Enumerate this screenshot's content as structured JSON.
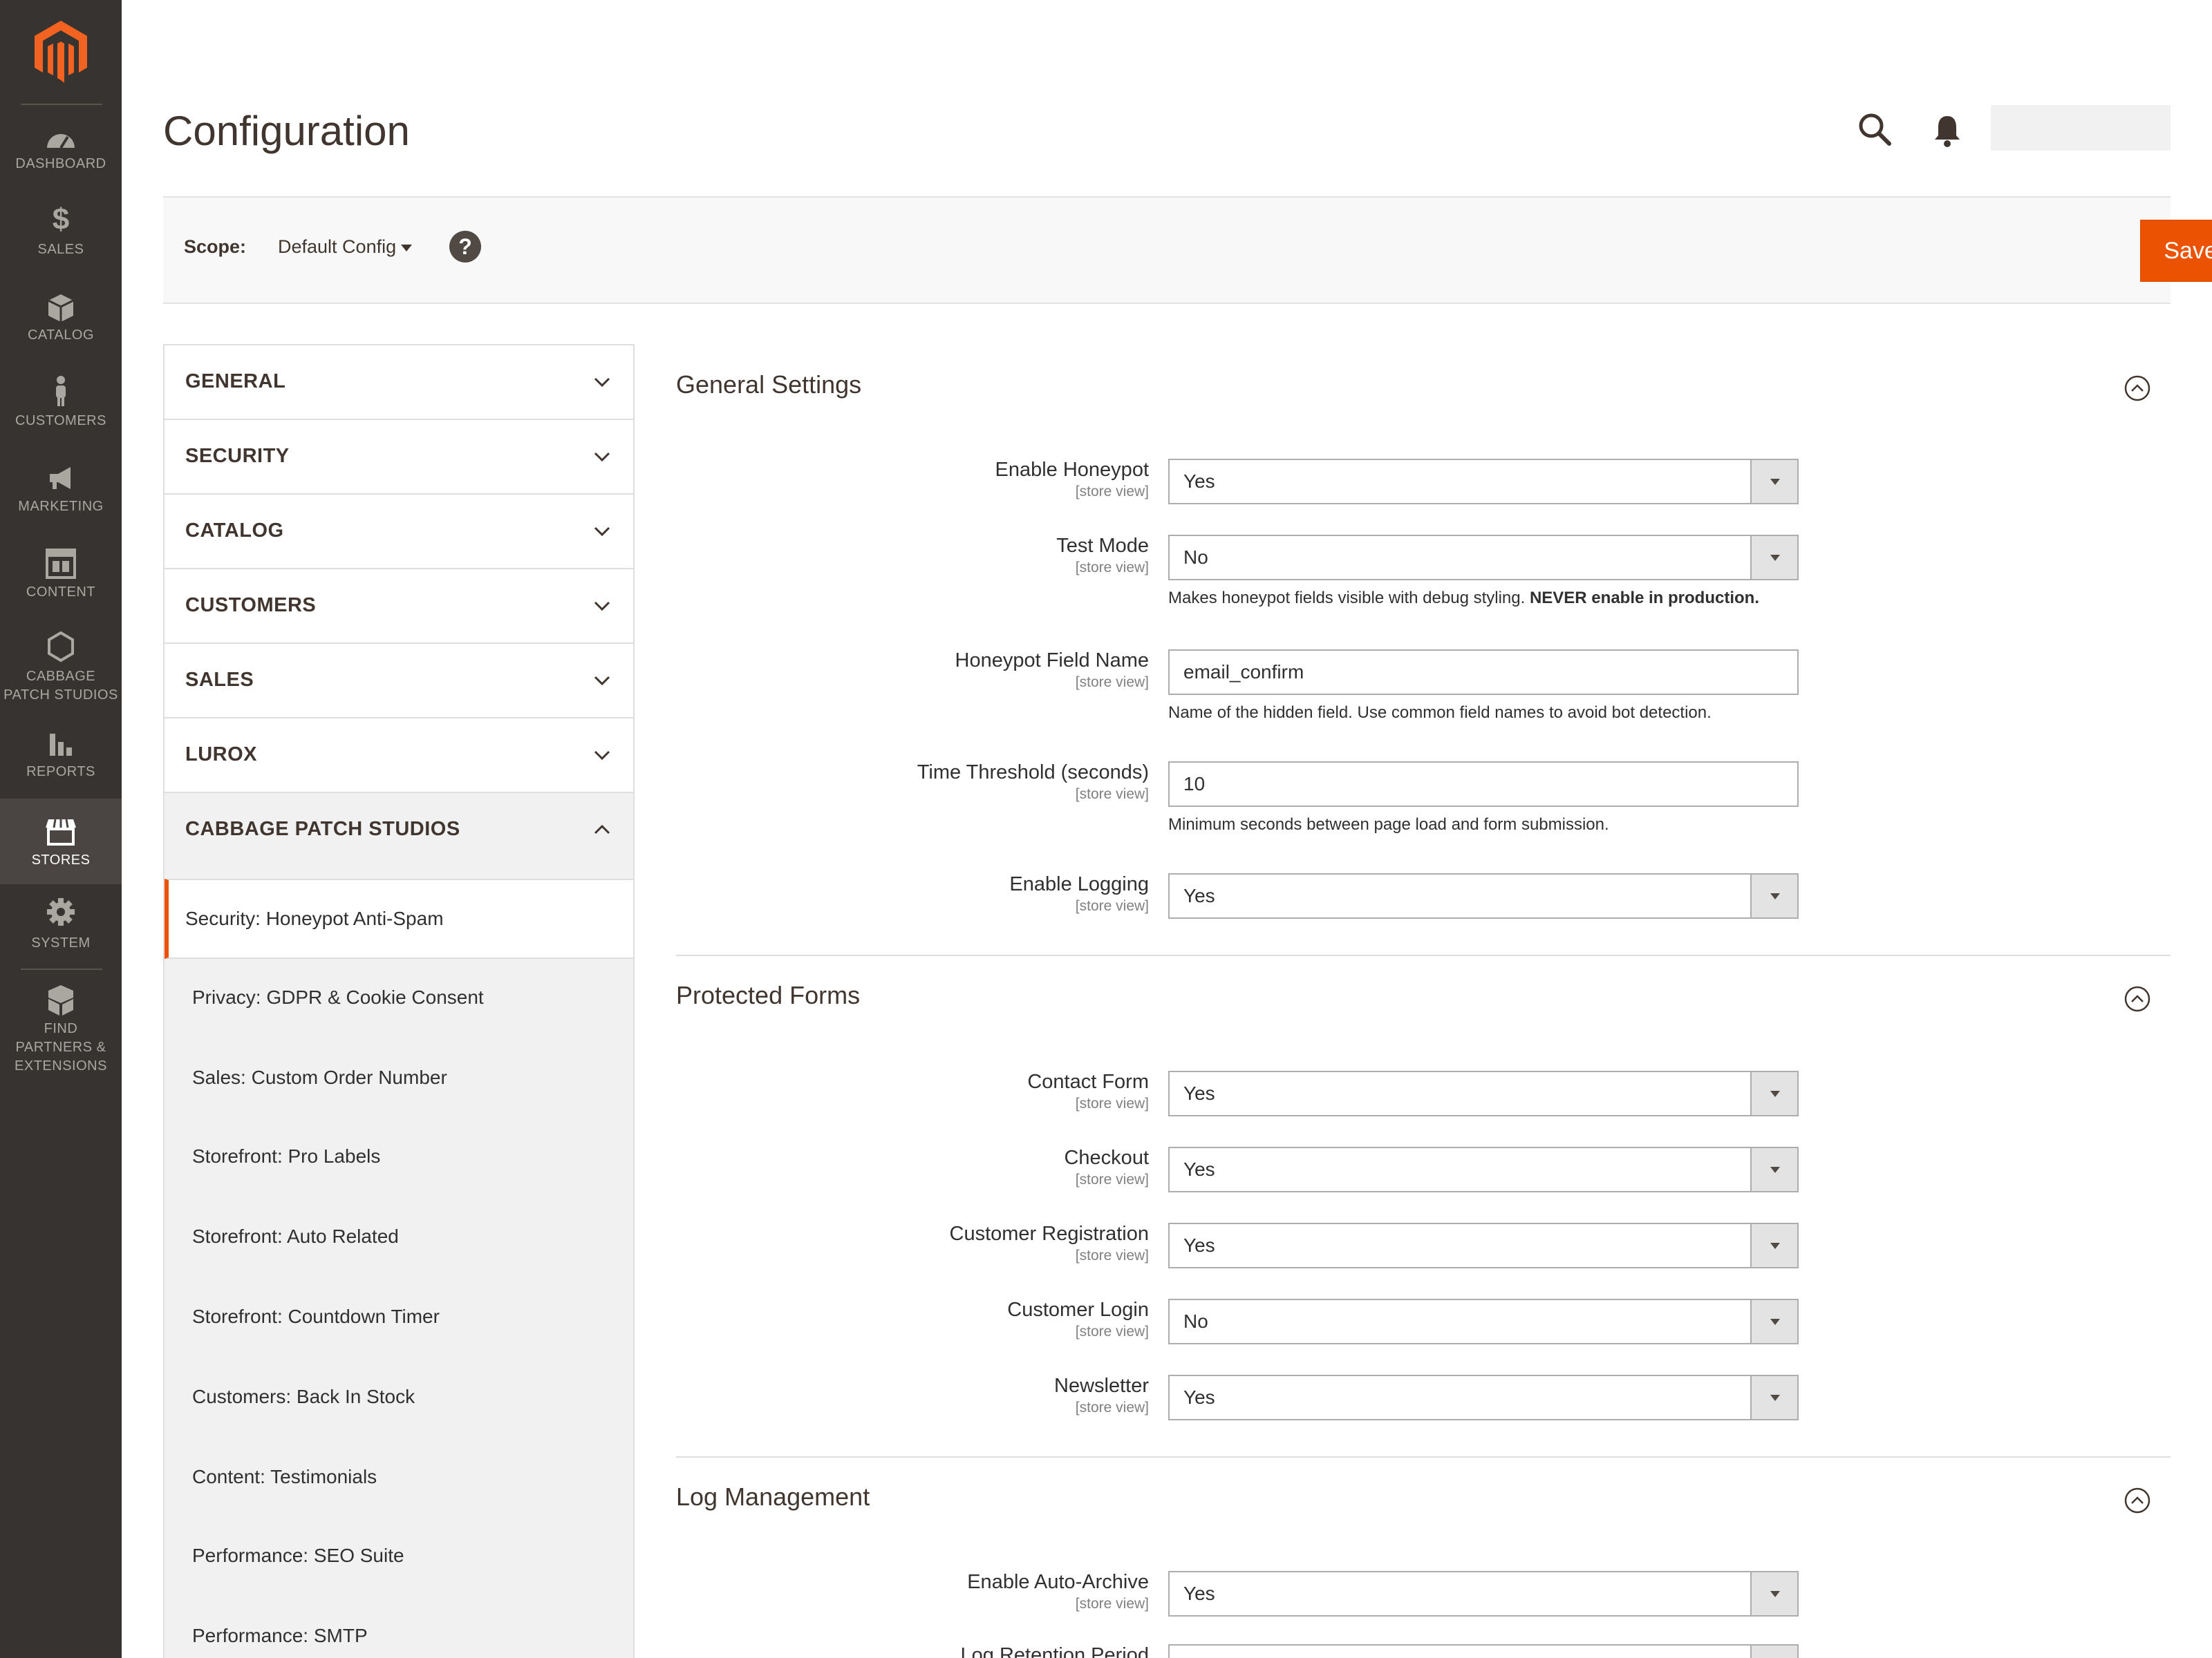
{
  "sidebar": {
    "items": [
      {
        "label": "DASHBOARD",
        "icon": "dashboard-icon"
      },
      {
        "label": "SALES",
        "icon": "dollar-icon"
      },
      {
        "label": "CATALOG",
        "icon": "box-icon"
      },
      {
        "label": "CUSTOMERS",
        "icon": "person-icon"
      },
      {
        "label": "MARKETING",
        "icon": "megaphone-icon"
      },
      {
        "label": "CONTENT",
        "icon": "layout-icon"
      },
      {
        "label": "CABBAGE",
        "label2": "PATCH STUDIOS",
        "icon": "hexagon-icon"
      },
      {
        "label": "REPORTS",
        "icon": "bar-chart-icon"
      },
      {
        "label": "STORES",
        "icon": "store-icon",
        "active": true
      },
      {
        "label": "SYSTEM",
        "icon": "gear-icon"
      },
      {
        "label": "FIND",
        "label2": "PARTNERS &",
        "label3": "EXTENSIONS",
        "icon": "cubes-icon"
      }
    ]
  },
  "header": {
    "title": "Configuration"
  },
  "scope": {
    "label": "Scope:",
    "value": "Default Config",
    "help": "?",
    "save_label": "Save Config"
  },
  "tabs": [
    {
      "label": "GENERAL",
      "expanded": false
    },
    {
      "label": "SECURITY",
      "expanded": false
    },
    {
      "label": "CATALOG",
      "expanded": false
    },
    {
      "label": "CUSTOMERS",
      "expanded": false
    },
    {
      "label": "SALES",
      "expanded": false
    },
    {
      "label": "LUROX",
      "expanded": false
    },
    {
      "label": "CABBAGE PATCH STUDIOS",
      "expanded": true
    }
  ],
  "subitems": [
    {
      "label": "Security: Honeypot Anti-Spam",
      "active": true
    },
    {
      "label": "Privacy: GDPR & Cookie Consent"
    },
    {
      "label": "Sales: Custom Order Number"
    },
    {
      "label": "Storefront: Pro Labels"
    },
    {
      "label": "Storefront: Auto Related"
    },
    {
      "label": "Storefront: Countdown Timer"
    },
    {
      "label": "Customers: Back In Stock"
    },
    {
      "label": "Content: Testimonials"
    },
    {
      "label": "Performance: SEO Suite"
    },
    {
      "label": "Performance: SMTP"
    }
  ],
  "scope_tag": "[store view]",
  "sections": {
    "general": {
      "title": "General Settings",
      "enable_honeypot": {
        "label": "Enable Honeypot",
        "value": "Yes"
      },
      "test_mode": {
        "label": "Test Mode",
        "value": "No",
        "note": "Makes honeypot fields visible with debug styling. ",
        "note_bold": "NEVER enable in production."
      },
      "field_name": {
        "label": "Honeypot Field Name",
        "value": "email_confirm",
        "note": "Name of the hidden field. Use common field names to avoid bot detection."
      },
      "time_threshold": {
        "label": "Time Threshold (seconds)",
        "value": "10",
        "note": "Minimum seconds between page load and form submission."
      },
      "enable_logging": {
        "label": "Enable Logging",
        "value": "Yes"
      }
    },
    "forms": {
      "title": "Protected Forms",
      "contact": {
        "label": "Contact Form",
        "value": "Yes"
      },
      "checkout": {
        "label": "Checkout",
        "value": "Yes"
      },
      "registration": {
        "label": "Customer Registration",
        "value": "Yes"
      },
      "login": {
        "label": "Customer Login",
        "value": "No"
      },
      "newsletter": {
        "label": "Newsletter",
        "value": "Yes"
      }
    },
    "logs": {
      "title": "Log Management",
      "auto_archive": {
        "label": "Enable Auto-Archive",
        "value": "Yes"
      },
      "retention": {
        "label": "Log Retention Period",
        "value": ""
      }
    }
  },
  "colors": {
    "accent": "#eb5202",
    "sidebar_bg": "#373330",
    "sidebar_active": "#4a4542"
  }
}
